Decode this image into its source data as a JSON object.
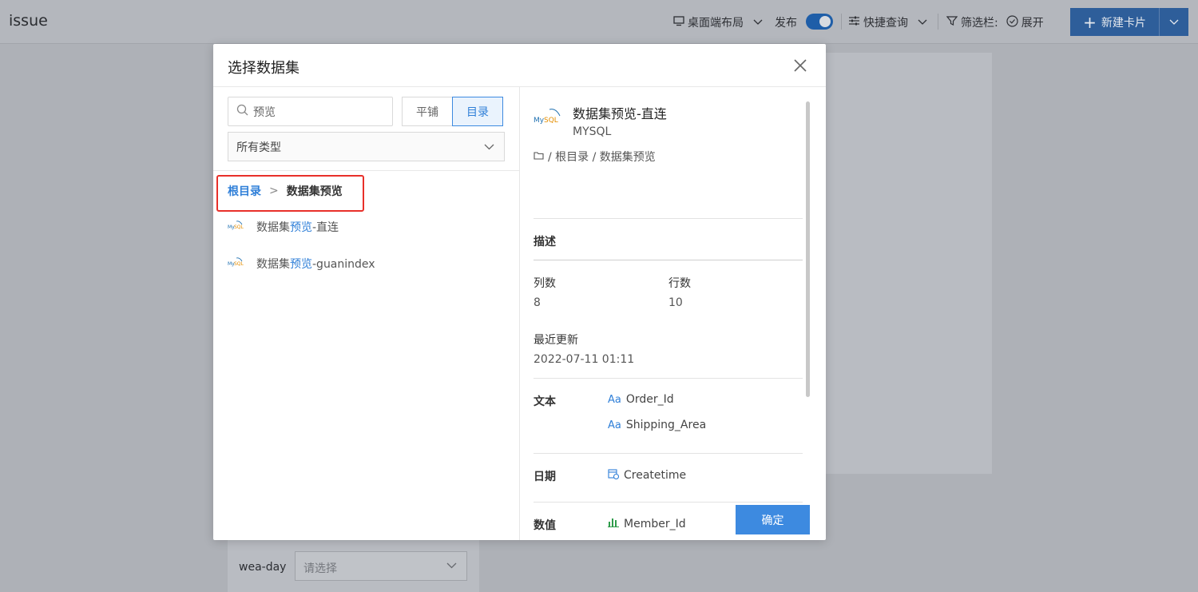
{
  "topbar": {
    "title": "issue",
    "layout_label": "桌面端布局",
    "publish_label": "发布",
    "publish_on": true,
    "quick_query_label": "快捷查询",
    "filter_bar_label": "筛选栏:",
    "expand_label": "展开",
    "new_card_label": "新建卡片"
  },
  "background": {
    "filter_label": "wea-day",
    "filter_placeholder": "请选择"
  },
  "modal": {
    "title": "选择数据集",
    "search": {
      "value": "预览",
      "placeholder": "预览"
    },
    "view_toggle": [
      "平铺",
      "目录"
    ],
    "view_selected": "目录",
    "type_select": "所有类型",
    "breadcrumb": {
      "root": "根目录",
      "separator": ">",
      "current": "数据集预览"
    },
    "datasets": [
      {
        "prefix": "数据集",
        "match": "预览",
        "suffix": "-直连",
        "icon": "mysql-logo"
      },
      {
        "prefix": "数据集",
        "match": "预览",
        "suffix": "-guanindex",
        "icon": "mysql-logo"
      }
    ],
    "detail": {
      "name": "数据集预览-直连",
      "type": "MYSQL",
      "path": "/ 根目录 / 数据集预览",
      "description_label": "描述",
      "columns_label": "列数",
      "columns_value": "8",
      "rows_label": "行数",
      "rows_value": "10",
      "updated_label": "最近更新",
      "updated_value": "2022-07-11 01:11",
      "text_label": "文本",
      "text_fields": [
        "Order_Id",
        "Shipping_Area"
      ],
      "date_label": "日期",
      "date_fields": [
        "Createtime"
      ],
      "number_label": "数值",
      "number_fields": [
        "Member_Id"
      ],
      "text_icon_glyph": "Aa"
    },
    "confirm_label": "确定"
  },
  "colors": {
    "accent": "#3d8ae0",
    "highlight_border": "#e8302a"
  }
}
